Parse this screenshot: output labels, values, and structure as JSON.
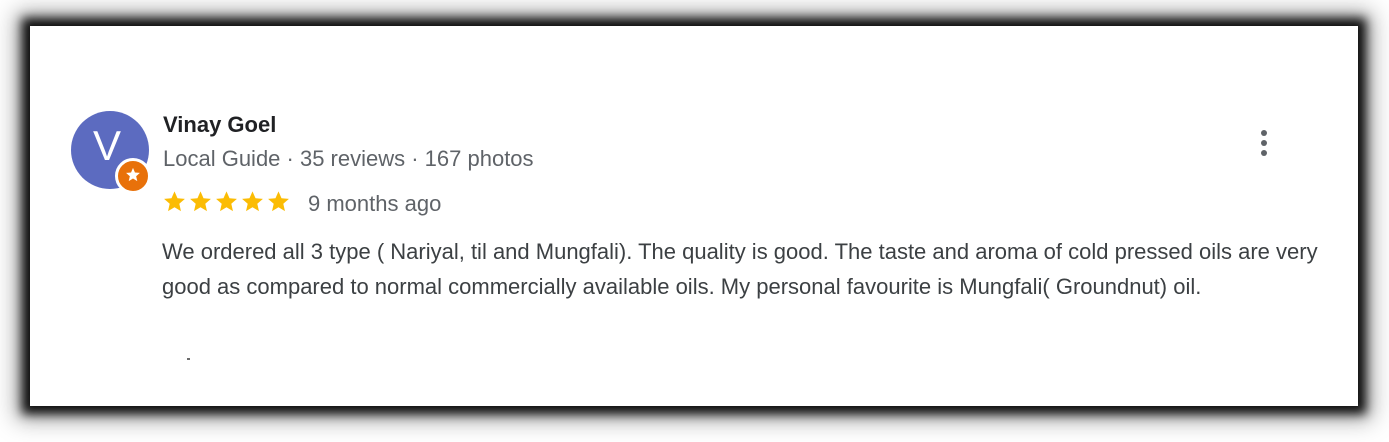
{
  "review": {
    "avatar_letter": "V",
    "author": "Vinay Goel",
    "meta": "Local Guide · 35 reviews · 167 photos",
    "rating": 5,
    "time": "9 months ago",
    "text": "We ordered all 3 type ( Nariyal, til and Mungfali). The quality is good. The taste and aroma of cold pressed oils are very good as compared to normal commercially available oils. My personal favourite is Mungfali( Groundnut) oil."
  },
  "colors": {
    "avatar_bg": "#5c6bc0",
    "badge_bg": "#e8710a",
    "star": "#fbbc04",
    "text_primary": "#202124",
    "text_secondary": "#5f6368"
  },
  "icons": {
    "more": "more-vert-icon",
    "badge": "local-guide-star-icon",
    "rating": "star-icon"
  }
}
